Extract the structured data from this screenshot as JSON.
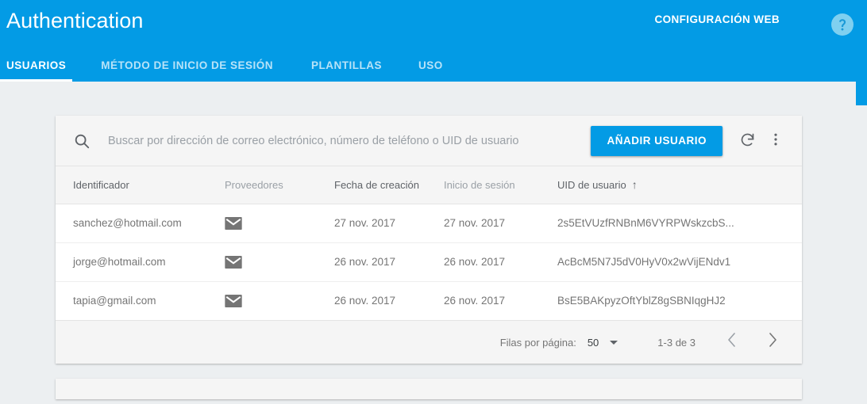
{
  "header": {
    "title": "Authentication",
    "web_config_label": "CONFIGURACIÓN WEB",
    "help_icon": "help-circle-icon",
    "background_color": "#039be5"
  },
  "tabs": [
    {
      "label": "USUARIOS",
      "active": true
    },
    {
      "label": "MÉTODO DE INICIO DE SESIÓN",
      "active": false
    },
    {
      "label": "PLANTILLAS",
      "active": false
    },
    {
      "label": "USO",
      "active": false
    }
  ],
  "toolbar": {
    "search_icon": "search-icon",
    "search_value": "",
    "search_placeholder": "Buscar por dirección de correo electrónico, número de teléfono o UID de usuario",
    "add_user_label": "AÑADIR USUARIO",
    "refresh_icon": "refresh-icon",
    "more_icon": "more-vertical-icon",
    "accent_color": "#039be5"
  },
  "table": {
    "columns": [
      {
        "label": "Identificador",
        "sorted": false
      },
      {
        "label": "Proveedores",
        "sorted": false
      },
      {
        "label": "Fecha de creación",
        "sorted": false
      },
      {
        "label": "Inicio de sesión",
        "sorted": false
      },
      {
        "label": "UID de usuario",
        "sorted": true,
        "sort_arrow": "↑"
      }
    ],
    "rows": [
      {
        "identifier": "sanchez@hotmail.com",
        "provider_icon": "email-icon",
        "created": "27 nov. 2017",
        "signed_in": "27 nov. 2017",
        "uid": "2s5EtVUzfRNBnM6VYRPWskzcbS..."
      },
      {
        "identifier": "jorge@hotmail.com",
        "provider_icon": "email-icon",
        "created": "26 nov. 2017",
        "signed_in": "26 nov. 2017",
        "uid": "AcBcM5N7J5dV0HyV0x2wVijENdv1"
      },
      {
        "identifier": "tapia@gmail.com",
        "provider_icon": "email-icon",
        "created": "26 nov. 2017",
        "signed_in": "26 nov. 2017",
        "uid": "BsE5BAKpyzOftYblZ8gSBNIqgHJ2"
      }
    ]
  },
  "pagination": {
    "rows_per_page_label": "Filas por página:",
    "rows_per_page_value": "50",
    "range_label": "1-3 de 3",
    "prev_icon": "chevron-left-icon",
    "next_icon": "chevron-right-icon"
  }
}
